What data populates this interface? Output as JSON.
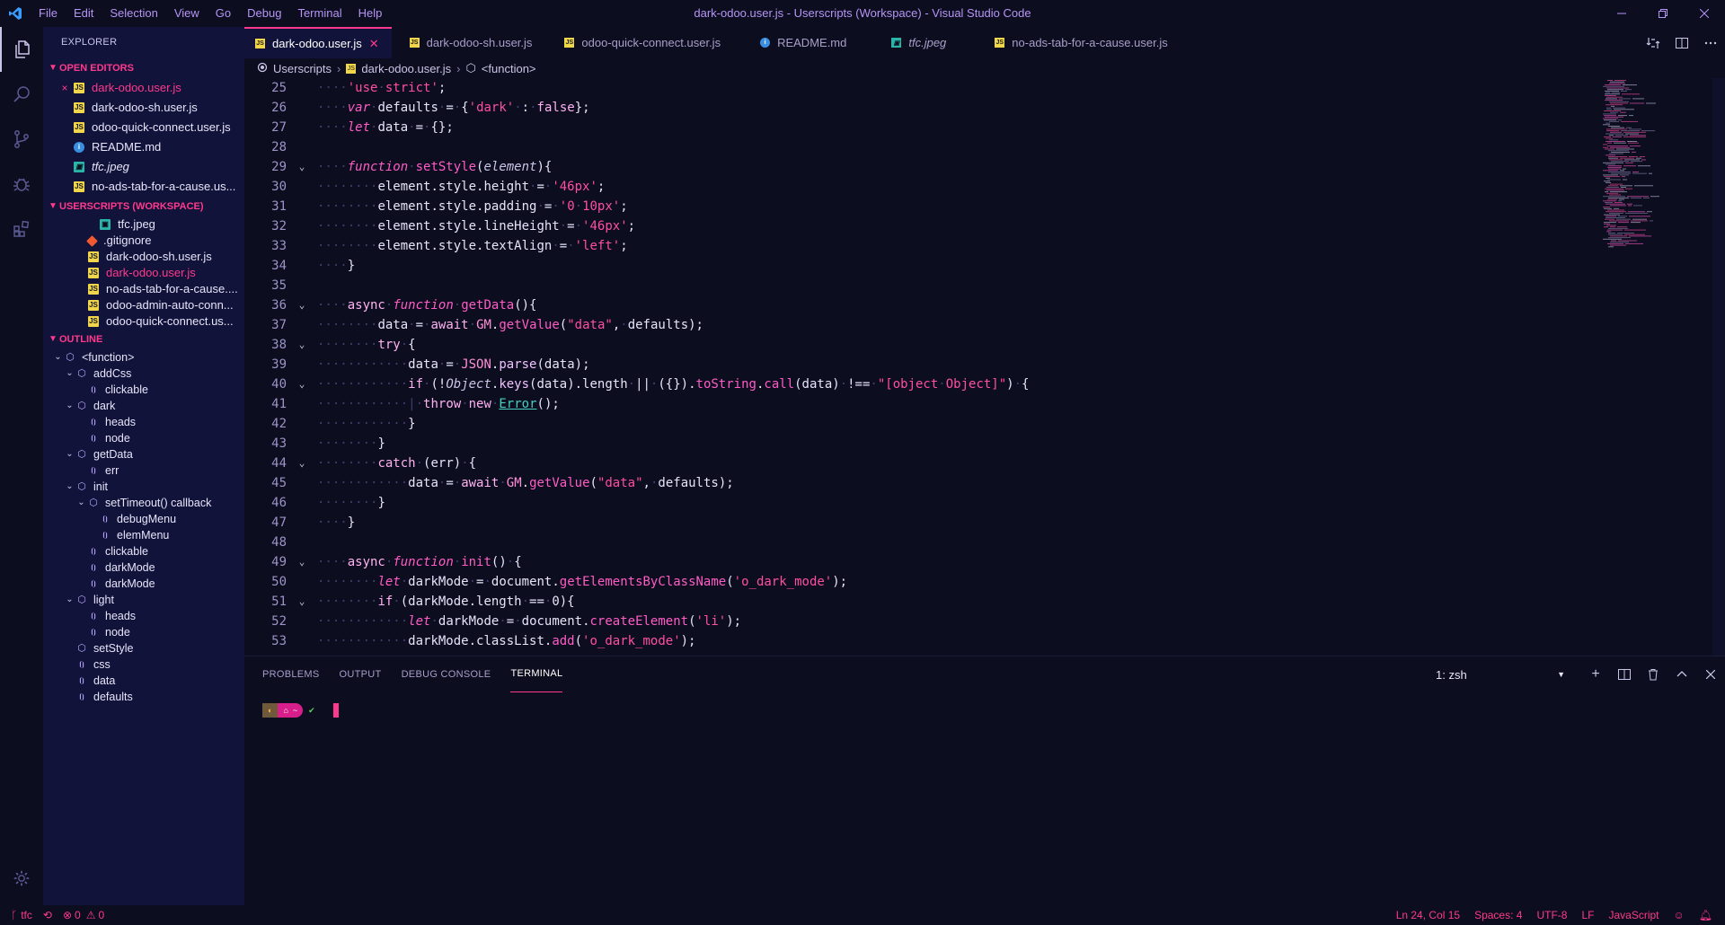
{
  "window": {
    "title": "dark-odoo.user.js - Userscripts (Workspace) - Visual Studio Code",
    "menu": [
      "File",
      "Edit",
      "Selection",
      "View",
      "Go",
      "Debug",
      "Terminal",
      "Help"
    ]
  },
  "sidebar": {
    "title": "EXPLORER",
    "open_editors_title": "OPEN EDITORS",
    "open_editors": [
      {
        "name": "dark-odoo.user.js",
        "icon": "js-icon",
        "modified": true
      },
      {
        "name": "dark-odoo-sh.user.js",
        "icon": "js-icon"
      },
      {
        "name": "odoo-quick-connect.user.js",
        "icon": "js-icon"
      },
      {
        "name": "README.md",
        "icon": "info-icon"
      },
      {
        "name": "tfc.jpeg",
        "icon": "image-icon"
      },
      {
        "name": "no-ads-tab-for-a-cause.us...",
        "icon": "js-icon"
      }
    ],
    "workspace_title": "USERSCRIPTS (WORKSPACE)",
    "workspace_files": [
      {
        "name": "tfc.jpeg",
        "icon": "image-icon"
      },
      {
        "name": ".gitignore",
        "icon": "git-icon"
      },
      {
        "name": "dark-odoo-sh.user.js",
        "icon": "js-icon"
      },
      {
        "name": "dark-odoo.user.js",
        "icon": "js-icon"
      },
      {
        "name": "no-ads-tab-for-a-cause....",
        "icon": "js-icon"
      },
      {
        "name": "odoo-admin-auto-conn...",
        "icon": "js-icon"
      },
      {
        "name": "odoo-quick-connect.us...",
        "icon": "js-icon"
      }
    ],
    "outline_title": "OUTLINE",
    "outline": [
      {
        "label": "<function>",
        "level": 0
      },
      {
        "label": "addCss",
        "level": 1
      },
      {
        "label": "clickable",
        "level": 2
      },
      {
        "label": "dark",
        "level": 1
      },
      {
        "label": "heads",
        "level": 2
      },
      {
        "label": "node",
        "level": 2
      },
      {
        "label": "getData",
        "level": 1
      },
      {
        "label": "err",
        "level": 2
      },
      {
        "label": "init",
        "level": 1
      },
      {
        "label": "setTimeout() callback",
        "level": 2
      },
      {
        "label": "debugMenu",
        "level": 3
      },
      {
        "label": "elemMenu",
        "level": 3
      },
      {
        "label": "clickable",
        "level": 2
      },
      {
        "label": "darkMode",
        "level": 2
      },
      {
        "label": "darkMode",
        "level": 2
      },
      {
        "label": "light",
        "level": 1
      },
      {
        "label": "heads",
        "level": 2
      },
      {
        "label": "node",
        "level": 2
      },
      {
        "label": "setStyle",
        "level": 1
      },
      {
        "label": "css",
        "level": 1
      },
      {
        "label": "data",
        "level": 1
      },
      {
        "label": "defaults",
        "level": 1
      }
    ]
  },
  "tabs": [
    {
      "label": "dark-odoo.user.js",
      "icon": "js-icon",
      "active": true
    },
    {
      "label": "dark-odoo-sh.user.js",
      "icon": "js-icon"
    },
    {
      "label": "odoo-quick-connect.user.js",
      "icon": "js-icon"
    },
    {
      "label": "README.md",
      "icon": "info-icon"
    },
    {
      "label": "tfc.jpeg",
      "icon": "image-icon"
    },
    {
      "label": "no-ads-tab-for-a-cause.user.js",
      "icon": "js-icon"
    }
  ],
  "breadcrumb": [
    "Userscripts",
    "dark-odoo.user.js",
    "<function>"
  ],
  "editor": {
    "line_numbers": [
      25,
      26,
      27,
      28,
      29,
      30,
      31,
      32,
      33,
      34,
      35,
      36,
      37,
      38,
      39,
      40,
      41,
      42,
      43,
      44,
      45,
      46,
      47,
      48,
      49,
      50,
      51,
      52,
      53
    ]
  },
  "panel": {
    "tabs": [
      "PROBLEMS",
      "OUTPUT",
      "DEBUG CONSOLE",
      "TERMINAL"
    ],
    "terminal_select": "1: zsh",
    "prompt_home": "~",
    "prompt_check": "✔"
  },
  "status": {
    "branch": "tfc",
    "errors": "0",
    "warnings": "0",
    "position": "Ln 24, Col 15",
    "spaces": "Spaces: 4",
    "encoding": "UTF-8",
    "eol": "LF",
    "language": "JavaScript"
  },
  "colors": {
    "accent": "#ff3a8c",
    "sidebar_bg": "#11133a",
    "editor_bg": "#0c0d1e",
    "menu_text": "#b695f5"
  }
}
